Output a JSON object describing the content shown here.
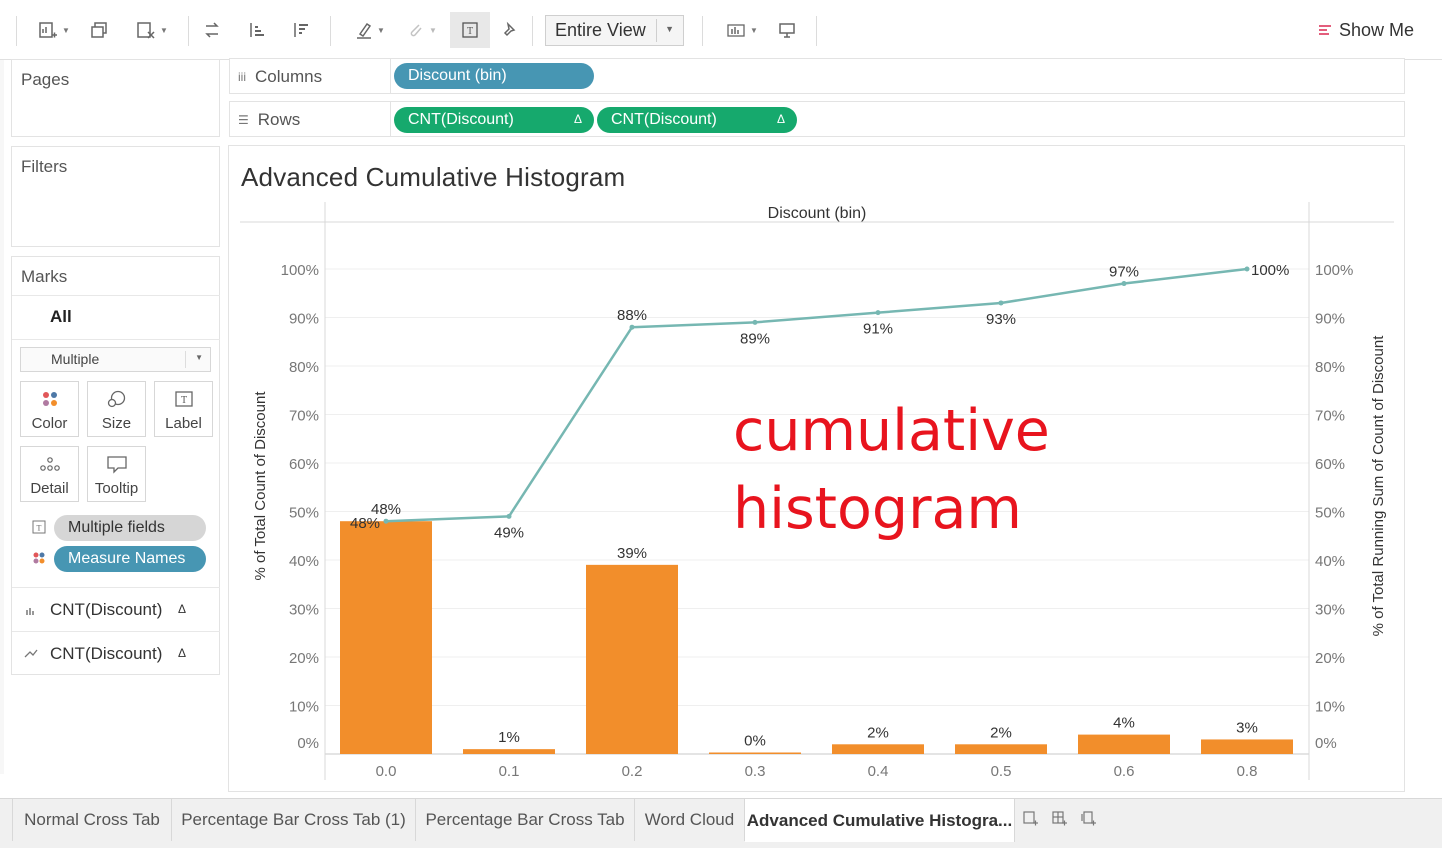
{
  "toolbar": {
    "view_select": "Entire View",
    "show_me": "Show Me"
  },
  "pages": {
    "title": "Pages"
  },
  "filters": {
    "title": "Filters"
  },
  "marks": {
    "title": "Marks",
    "all_label": "All",
    "mark_type": "Multiple",
    "buttons": [
      "Color",
      "Size",
      "Label",
      "Detail",
      "Tooltip"
    ],
    "fields": [
      {
        "name": "Multiple fields",
        "style": "gray"
      },
      {
        "name": "Measure Names",
        "style": "blue"
      }
    ],
    "measures": [
      "CNT(Discount)",
      "CNT(Discount)"
    ],
    "delta": "Δ"
  },
  "columns": {
    "label": "Columns",
    "pills": [
      "Discount (bin)"
    ]
  },
  "rows": {
    "label": "Rows",
    "pills": [
      "CNT(Discount)",
      "CNT(Discount)"
    ],
    "delta": "Δ"
  },
  "viz": {
    "title": "Advanced Cumulative Histogram",
    "annotation_line1": "cumulative",
    "annotation_line2": "histogram"
  },
  "chart_data": {
    "type": "bar",
    "title": "Advanced Cumulative Histogram",
    "header": "Discount (bin)",
    "ylabel": "% of Total Count of Discount",
    "ylabel_right": "% of Total Running Sum of Count of Discount",
    "categories": [
      "0.0",
      "0.1",
      "0.2",
      "0.3",
      "0.4",
      "0.5",
      "0.6",
      "0.8"
    ],
    "series": [
      {
        "type": "bar",
        "values": [
          48,
          1,
          39,
          0,
          2,
          2,
          4,
          3
        ],
        "labels": [
          "48%",
          "1%",
          "39%",
          "0%",
          "2%",
          "2%",
          "4%",
          "3%"
        ],
        "color": "#f28e2b"
      },
      {
        "type": "line",
        "values": [
          48,
          49,
          88,
          89,
          91,
          93,
          97,
          100
        ],
        "labels": [
          "48%",
          "49%",
          "88%",
          "89%",
          "91%",
          "93%",
          "97%",
          "100%"
        ],
        "color": "#76b7b2"
      }
    ],
    "yticks": [
      "0%",
      "10%",
      "20%",
      "30%",
      "40%",
      "50%",
      "60%",
      "70%",
      "80%",
      "90%",
      "100%"
    ],
    "ylim": [
      0,
      100
    ],
    "grid": true
  },
  "tabs": [
    {
      "label": "Normal Cross Tab",
      "active": false
    },
    {
      "label": "Percentage Bar Cross Tab (1)",
      "active": false
    },
    {
      "label": "Percentage Bar Cross Tab",
      "active": false
    },
    {
      "label": "Word Cloud",
      "active": false
    },
    {
      "label": "Advanced Cumulative Histogra...",
      "active": true
    }
  ],
  "colors": {
    "bar": "#f28e2b",
    "line": "#76b7b2",
    "annotation": "#e8141e",
    "pill_blue": "#4796b3",
    "pill_green": "#16a96d"
  }
}
